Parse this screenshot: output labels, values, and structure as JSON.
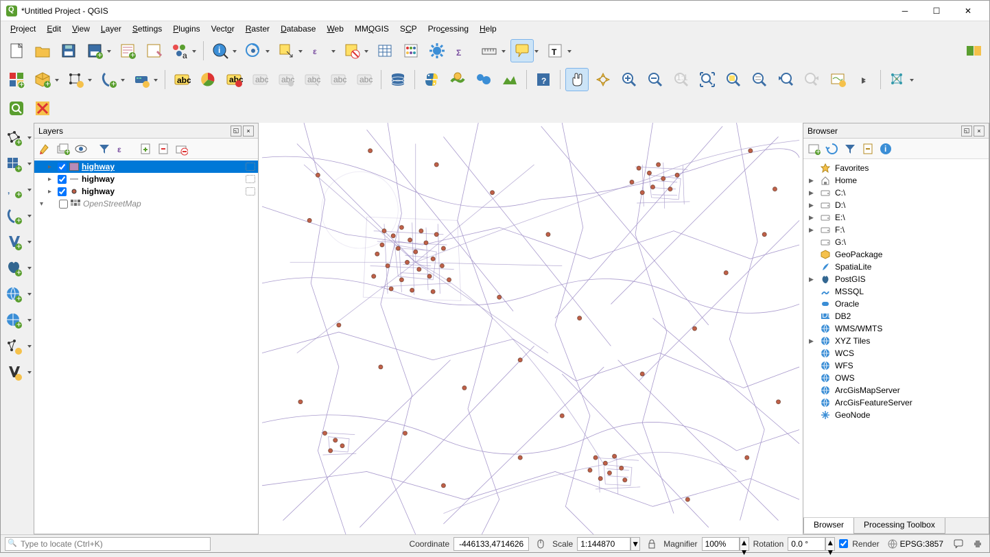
{
  "window": {
    "title": "*Untitled Project - QGIS"
  },
  "menu": [
    "Project",
    "Edit",
    "View",
    "Layer",
    "Settings",
    "Plugins",
    "Vector",
    "Raster",
    "Database",
    "Web",
    "MMQGIS",
    "SCP",
    "Processing",
    "Help"
  ],
  "layers_panel": {
    "title": "Layers",
    "items": [
      {
        "checked": true,
        "name": "highway",
        "selected": true,
        "swatch": "poly"
      },
      {
        "checked": true,
        "name": "highway",
        "selected": false,
        "swatch": "line"
      },
      {
        "checked": true,
        "name": "highway",
        "selected": false,
        "swatch": "point"
      },
      {
        "checked": false,
        "name": "OpenStreetMap",
        "selected": false,
        "swatch": "raster",
        "italic": true
      }
    ]
  },
  "browser_panel": {
    "title": "Browser",
    "items": [
      {
        "icon": "star",
        "label": "Favorites",
        "exp": ""
      },
      {
        "icon": "home",
        "label": "Home",
        "exp": "▶"
      },
      {
        "icon": "drive",
        "label": "C:\\",
        "exp": "▶"
      },
      {
        "icon": "drive",
        "label": "D:\\",
        "exp": "▶"
      },
      {
        "icon": "drive",
        "label": "E:\\",
        "exp": "▶"
      },
      {
        "icon": "drive",
        "label": "F:\\",
        "exp": "▶"
      },
      {
        "icon": "drive",
        "label": "G:\\",
        "exp": ""
      },
      {
        "icon": "gpkg",
        "label": "GeoPackage",
        "exp": ""
      },
      {
        "icon": "feather",
        "label": "SpatiaLite",
        "exp": ""
      },
      {
        "icon": "pg",
        "label": "PostGIS",
        "exp": "▶"
      },
      {
        "icon": "mssql",
        "label": "MSSQL",
        "exp": ""
      },
      {
        "icon": "oracle",
        "label": "Oracle",
        "exp": ""
      },
      {
        "icon": "db2",
        "label": "DB2",
        "exp": ""
      },
      {
        "icon": "globe",
        "label": "WMS/WMTS",
        "exp": ""
      },
      {
        "icon": "globe",
        "label": "XYZ Tiles",
        "exp": "▶"
      },
      {
        "icon": "globe",
        "label": "WCS",
        "exp": ""
      },
      {
        "icon": "globe",
        "label": "WFS",
        "exp": ""
      },
      {
        "icon": "globe",
        "label": "OWS",
        "exp": ""
      },
      {
        "icon": "globe",
        "label": "ArcGisMapServer",
        "exp": ""
      },
      {
        "icon": "globe",
        "label": "ArcGisFeatureServer",
        "exp": ""
      },
      {
        "icon": "snow",
        "label": "GeoNode",
        "exp": ""
      }
    ],
    "tabs": [
      "Browser",
      "Processing Toolbox"
    ]
  },
  "status": {
    "locate_placeholder": "Type to locate (Ctrl+K)",
    "coord_label": "Coordinate",
    "coord_value": "-446133,4714626",
    "scale_label": "Scale",
    "scale_value": "1:144870",
    "mag_label": "Magnifier",
    "mag_value": "100%",
    "rot_label": "Rotation",
    "rot_value": "0.0 °",
    "render_label": "Render",
    "crs": "EPSG:3857"
  }
}
